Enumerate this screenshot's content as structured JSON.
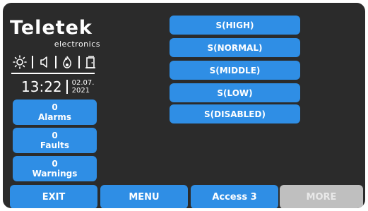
{
  "brand": {
    "name": "Teletek",
    "subtitle": "electronics"
  },
  "status_icons": [
    "sun-icon",
    "speaker-icon",
    "flame-icon",
    "door-icon"
  ],
  "clock": {
    "time": "13:22",
    "date_line1": "02.07.",
    "date_line2": "2021"
  },
  "counters": [
    {
      "count": "0",
      "label": "Alarms"
    },
    {
      "count": "0",
      "label": "Faults"
    },
    {
      "count": "0",
      "label": "Warnings"
    }
  ],
  "modes": [
    {
      "label": "S(HIGH)"
    },
    {
      "label": "S(NORMAL)"
    },
    {
      "label": "S(MIDDLE)"
    },
    {
      "label": "S(LOW)"
    },
    {
      "label": "S(DISABLED)"
    }
  ],
  "bottom_bar": {
    "exit": "EXIT",
    "menu": "MENU",
    "access": "Access 3",
    "more": "MORE"
  },
  "colors": {
    "panel_bg": "#2b2b2b",
    "button_blue": "#2f8ee5",
    "disabled_gray": "#bfbfbf"
  }
}
